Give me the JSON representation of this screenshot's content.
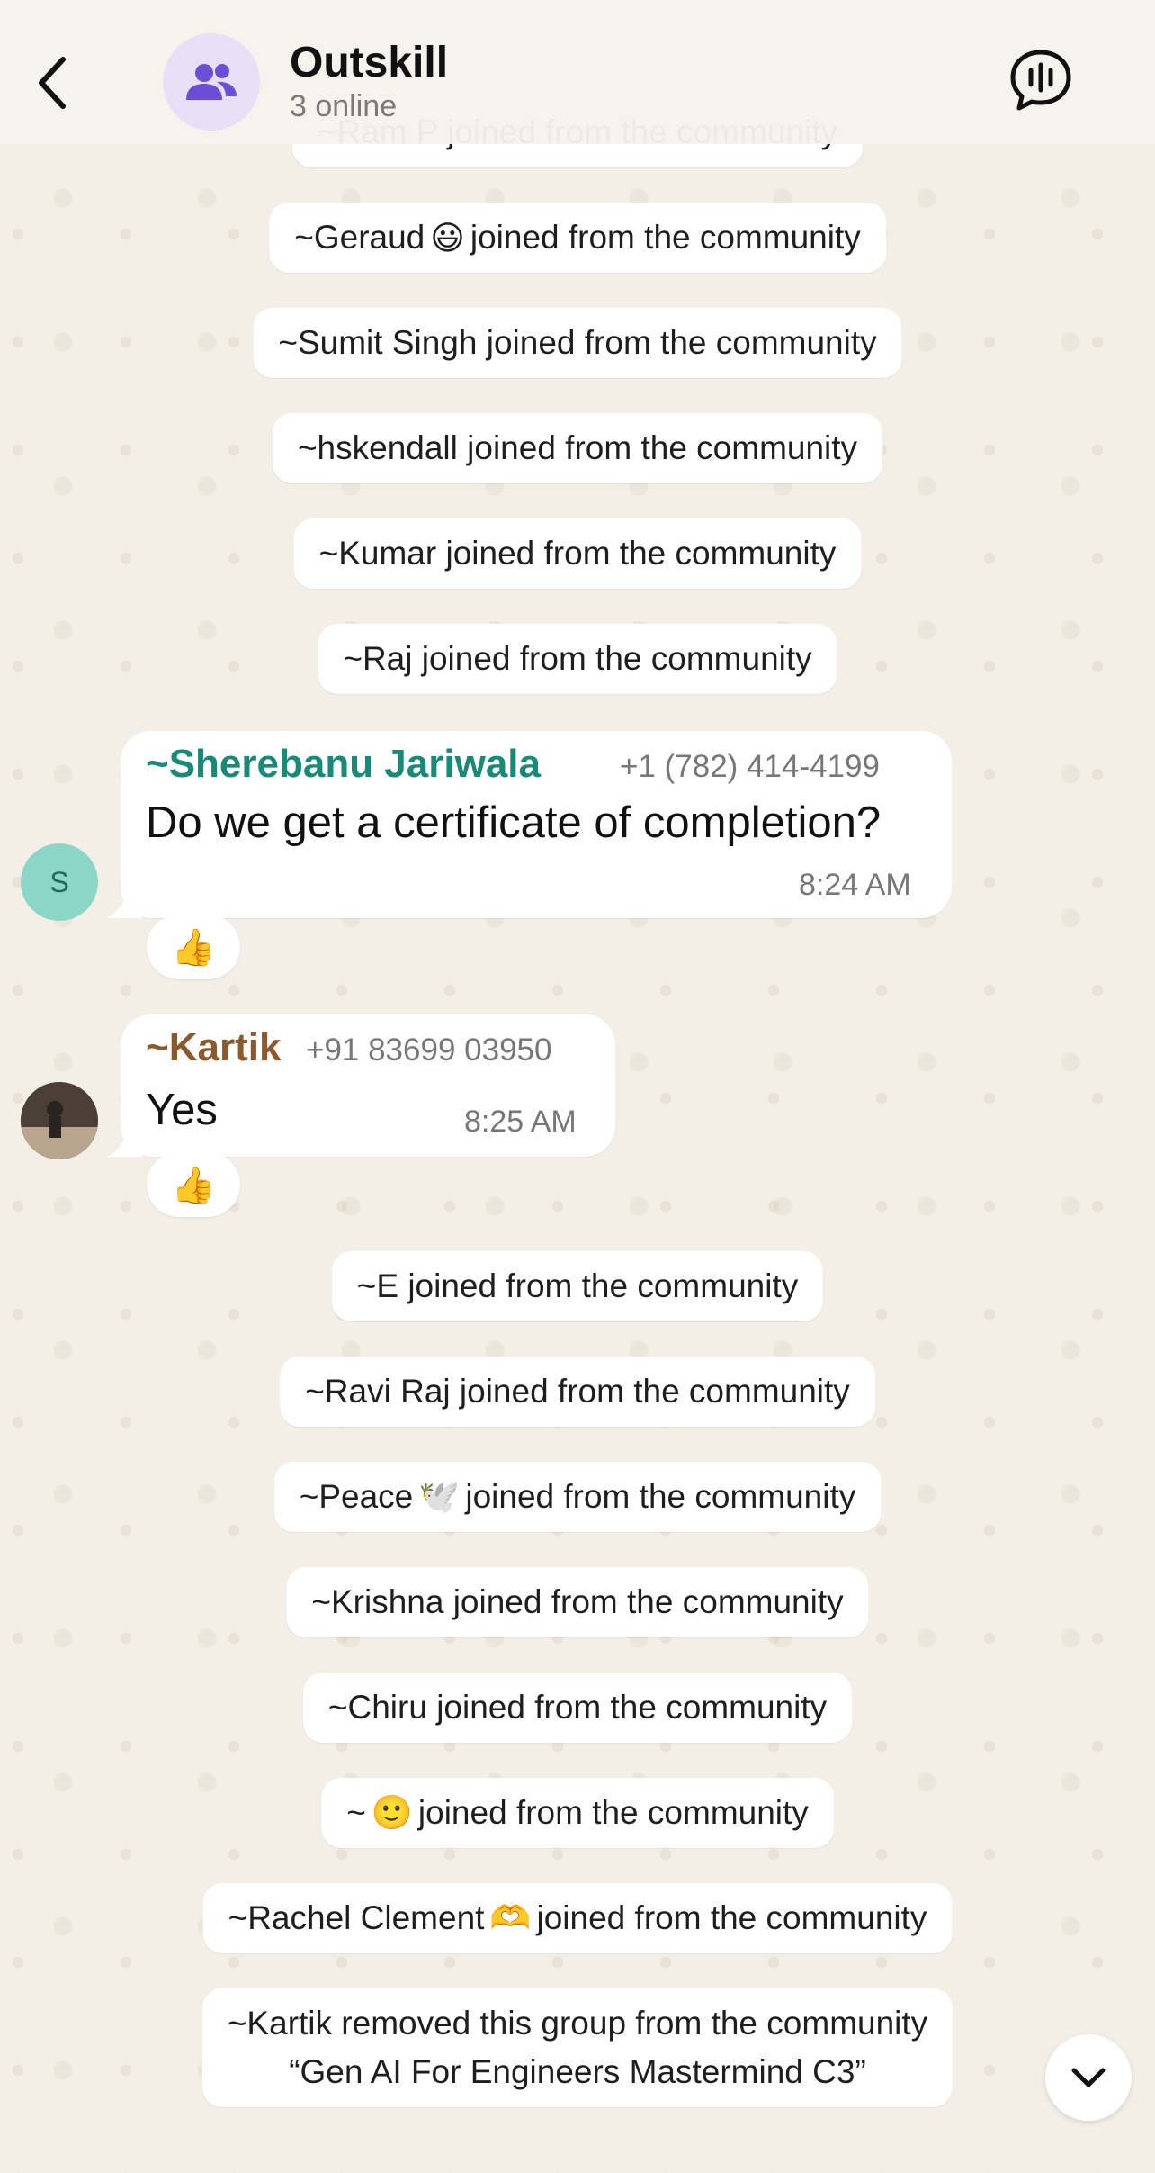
{
  "header": {
    "title": "Outskill",
    "subtitle": "3 online"
  },
  "system_messages": {
    "partial_top": "~Ram P joined from the community",
    "geraud_pre": "~Geraud",
    "geraud_emoji": "😃",
    "geraud_post": "joined from the community",
    "sumit": "~Sumit Singh joined from the community",
    "hskendall": "~hskendall joined from the community",
    "kumar": "~Kumar joined from the community",
    "raj": "~Raj joined from the community",
    "e": "~E joined from the community",
    "ravi_raj": "~Ravi Raj joined from the community",
    "peace_pre": "~Peace",
    "peace_emoji": "🕊️",
    "peace_post": "joined from the community",
    "krishna": "~Krishna joined from the community",
    "chiru": "~Chiru joined from the community",
    "smile_pre": "~",
    "smile_emoji": "🙂",
    "smile_post": "joined from the community",
    "rachel_pre": "~Rachel Clement",
    "rachel_emoji": "🫶",
    "rachel_post": "joined from the community",
    "removed_line1": "~Kartik removed this group from the community",
    "removed_line2": "“Gen AI For Engineers Mastermind C3”"
  },
  "messages": [
    {
      "avatar_initial": "S",
      "sender": "~Sherebanu Jariwala",
      "sender_color": "#1a8a78",
      "phone": "+1 (782) 414-4199",
      "text": "Do we get a certificate of completion?",
      "time": "8:24 AM",
      "reaction": "👍"
    },
    {
      "sender": "~Kartik",
      "sender_color": "#8a5a2e",
      "phone": "+91 83699 03950",
      "text": "Yes",
      "time": "8:25 AM",
      "reaction": "👍"
    }
  ],
  "icons": {
    "back": "chevron-left-icon",
    "group": "people-icon",
    "voice": "voice-chat-icon",
    "scroll": "chevron-down-icon"
  },
  "colors": {
    "accent": "#6a4fd6",
    "wallpaper": "#f3efe7"
  }
}
